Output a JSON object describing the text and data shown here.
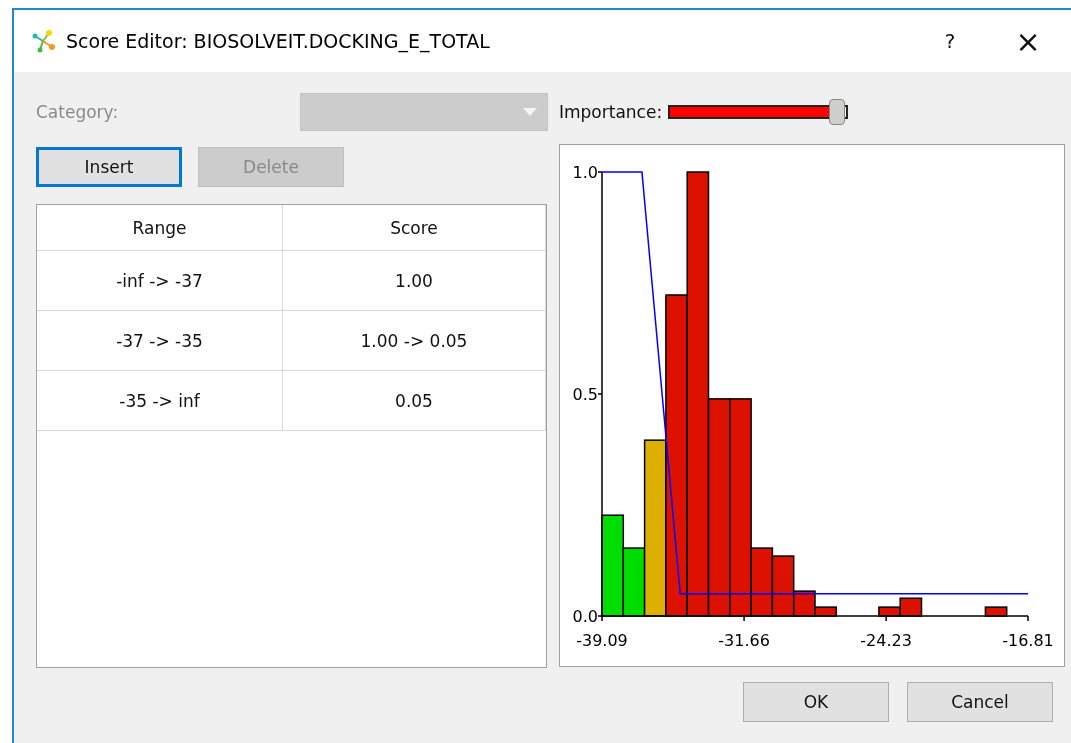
{
  "window": {
    "title": "Score Editor: BIOSOLVEIT.DOCKING_E_TOTAL",
    "buttons": [
      {
        "kind": "help",
        "label": "?"
      },
      {
        "kind": "close",
        "label": "×"
      }
    ]
  },
  "category": {
    "label": "Category:",
    "disabled": true
  },
  "importance": {
    "label": "Importance:",
    "level": 0.94
  },
  "actions": [
    {
      "label": "Insert",
      "disabled": false,
      "focused": true
    },
    {
      "label": "Delete",
      "disabled": true,
      "focused": false
    }
  ],
  "table": {
    "columns": [
      "Range",
      "Score"
    ],
    "rows": [
      [
        "-inf -> -37",
        "1.00"
      ],
      [
        "-37 -> -35",
        "1.00 -> 0.05"
      ],
      [
        "-35 -> inf",
        "0.05"
      ]
    ]
  },
  "chart": {
    "chart_data": {
      "type": "bar",
      "xlim": [
        -39.09,
        -16.81
      ],
      "ylim": [
        0,
        1
      ],
      "xticks": [
        {
          "value": -39.09,
          "label": "-39.09"
        },
        {
          "value": -31.66,
          "label": "-31.66"
        },
        {
          "value": -24.23,
          "label": "-24.23"
        },
        {
          "value": -16.81,
          "label": "-16.81"
        }
      ],
      "yticks": [
        {
          "value": 0,
          "label": "0.0"
        },
        {
          "value": 0.5,
          "label": "0.5"
        },
        {
          "value": 1,
          "label": "1.0"
        }
      ],
      "x": [
        -38.533,
        -37.419,
        -36.305,
        -35.191,
        -34.077,
        -32.963,
        -31.849,
        -30.735,
        -29.621,
        -28.507,
        -27.393,
        -26.279,
        -25.165,
        -24.051,
        -22.937,
        -21.823,
        -20.709,
        -19.595,
        -18.481,
        -17.367
      ],
      "series": [
        {
          "color": "#00dd00",
          "values": [
            0.227,
            0.153,
            null,
            null,
            null,
            null,
            null,
            null,
            null,
            null,
            null,
            null,
            null,
            null,
            null,
            null,
            null,
            null,
            null,
            null
          ]
        },
        {
          "color": "#ddb000",
          "values": [
            null,
            null,
            0.396,
            null,
            null,
            null,
            null,
            null,
            null,
            null,
            null,
            null,
            null,
            null,
            null,
            null,
            null,
            null,
            null,
            null
          ]
        },
        {
          "color": "#dd1100",
          "values": [
            null,
            null,
            null,
            0.723,
            1.0,
            0.489,
            0.489,
            0.153,
            0.135,
            0.056,
            0.02,
            0,
            0,
            0.02,
            0.04,
            0,
            0,
            0,
            0.02,
            0
          ]
        },
        {
          "color": "#0000ff",
          "type": "line",
          "x": [
            -39.09,
            -37,
            -35,
            -16.81
          ],
          "values": [
            1,
            1,
            0.05,
            0.05
          ]
        }
      ]
    }
  },
  "footer_buttons": [
    "OK",
    "Cancel"
  ]
}
